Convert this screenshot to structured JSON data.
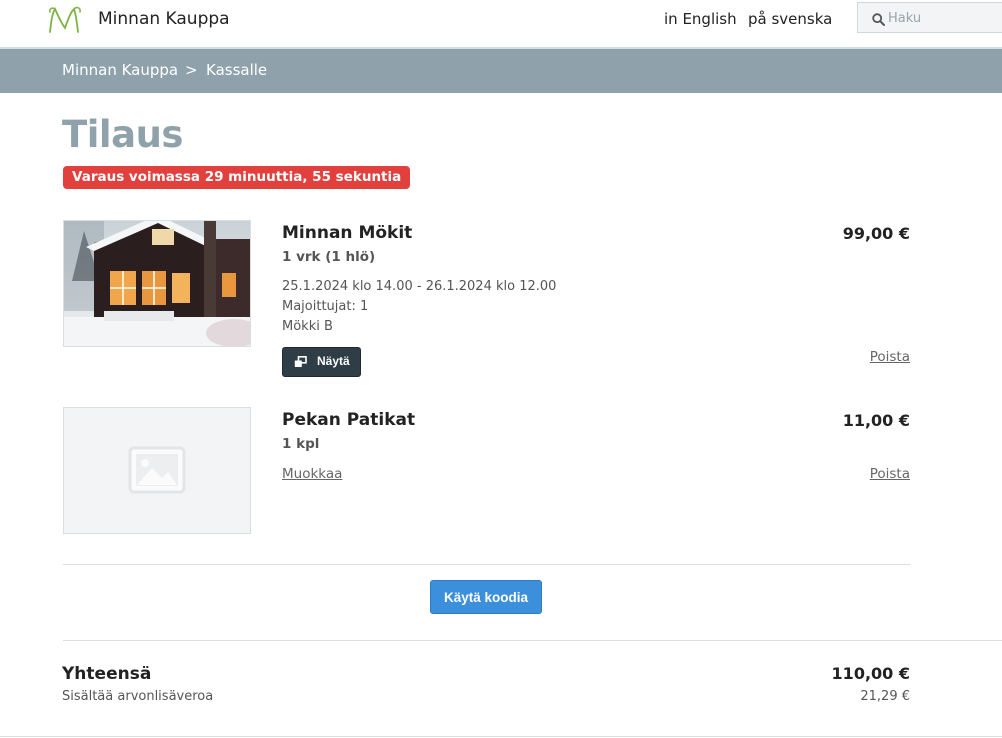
{
  "header": {
    "shop_name": "Minnan Kauppa",
    "lang_english": "in English",
    "lang_swedish": "på svenska",
    "search_placeholder": "Haku",
    "logo_color": "#7cb342"
  },
  "breadcrumb": {
    "home": "Minnan Kauppa",
    "separator": ">",
    "current": "Kassalle",
    "bar_color": "#8fa2ab"
  },
  "order": {
    "title": "Tilaus",
    "timer": "Varaus voimassa 29 minuuttia, 55 sekuntia",
    "timer_color": "#e2403d"
  },
  "items": [
    {
      "name": "Minnan Mökit",
      "quantity": "1 vrk (1 hlö)",
      "dates": "25.1.2024 klo 14.00 - 26.1.2024 klo 12.00",
      "guests": "Majoittujat: 1",
      "cabin": "Mökki B",
      "price": "99,00 €",
      "show_label": "Näytä",
      "remove_label": "Poista"
    },
    {
      "name": "Pekan Patikat",
      "quantity": "1 kpl",
      "edit_label": "Muokkaa",
      "price": "11,00 €",
      "remove_label": "Poista"
    }
  ],
  "code_button": {
    "label": "Käytä koodia",
    "color": "#3b8fdb"
  },
  "totals": {
    "label": "Yhteensä",
    "total": "110,00 €",
    "vat_label": "Sisältää arvonlisäveroa",
    "vat_amount": "21,29 €"
  }
}
